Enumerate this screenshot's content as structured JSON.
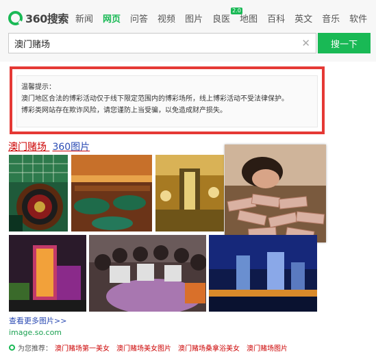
{
  "logo": {
    "brand": "360搜索"
  },
  "nav": {
    "items": [
      {
        "label": "新闻"
      },
      {
        "label": "网页",
        "active": true
      },
      {
        "label": "问答"
      },
      {
        "label": "视频"
      },
      {
        "label": "图片"
      },
      {
        "label": "良医",
        "badge": "2.0"
      },
      {
        "label": "地图"
      },
      {
        "label": "百科"
      },
      {
        "label": "英文"
      },
      {
        "label": "音乐"
      },
      {
        "label": "软件"
      }
    ]
  },
  "search": {
    "value": "澳门赌场",
    "button_label": "搜一下",
    "clear_icon": "close-icon"
  },
  "warning": {
    "title": "温馨提示：",
    "line1": "澳门地区合法的博彩活动仅于线下限定范围内的博彩场所，线上博彩活动不受法律保护。",
    "line2": "博彩类网站存在欺诈风险，请您谨防上当受骗，以免造成财产损失。"
  },
  "result": {
    "title_main": "澳门赌场",
    "title_sub": "360图片",
    "more_link": "查看更多图片>>",
    "url": "image.so.com"
  },
  "recommend": {
    "label": "为您推荐：",
    "links": [
      "澳门赌场第一美女",
      "澳门赌场美女图片",
      "澳门赌场桑拿浴美女",
      "澳门赌场图片"
    ]
  },
  "colors": {
    "accent": "#19b955",
    "warning_border": "#e53935",
    "link_red": "#cc0000",
    "link_blue": "#2a4ab3"
  }
}
